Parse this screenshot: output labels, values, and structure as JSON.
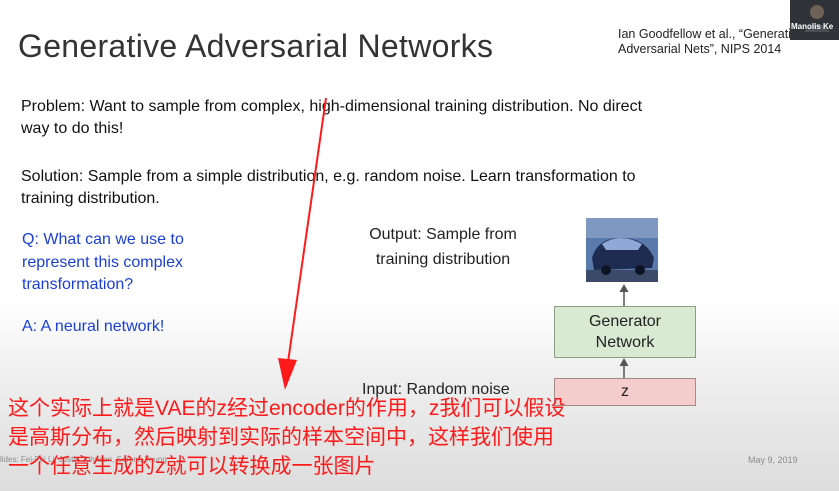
{
  "slide": {
    "title": "Generative Adversarial Networks",
    "citation_line1": "Ian Goodfellow et al., “Generative",
    "citation_line2": "Adversarial Nets”, NIPS 2014",
    "problem_line1": "Problem: Want to sample from complex, high-dimensional training distribution. No direct",
    "problem_line2": "way to do this!",
    "solution_line1": "Solution: Sample from a simple distribution, e.g. random noise. Learn transformation to",
    "solution_line2": "training distribution.",
    "question_line1": "Q: What can we use to",
    "question_line2": "represent this complex",
    "question_line3": "transformation?",
    "answer": "A: A neural network!",
    "footer_left": "lides: Fei-Fei Li, Justin Johnson, Serena Yeung",
    "footer_date": "May 9, 2019"
  },
  "diagram": {
    "output_label_line1": "Output: Sample from",
    "output_label_line2": "training distribution",
    "generator_line1": "Generator",
    "generator_line2": "Network",
    "input_label": "Input: Random noise",
    "noise_var": "z"
  },
  "webcam": {
    "name": "Manolis Ke"
  },
  "subtitle": {
    "line1": "这个实际上就是VAE的z经过encoder的作用，z我们可以假设",
    "line2": "是高斯分布，然后映射到实际的样本空间中，这样我们使用",
    "line3": "一个任意生成的z就可以转换成一张图片"
  },
  "colors": {
    "annotation_red": "#ff1a1a",
    "question_blue": "#1a3fd6",
    "generator_fill": "#d9ead3",
    "noise_fill": "#f4cccc"
  }
}
